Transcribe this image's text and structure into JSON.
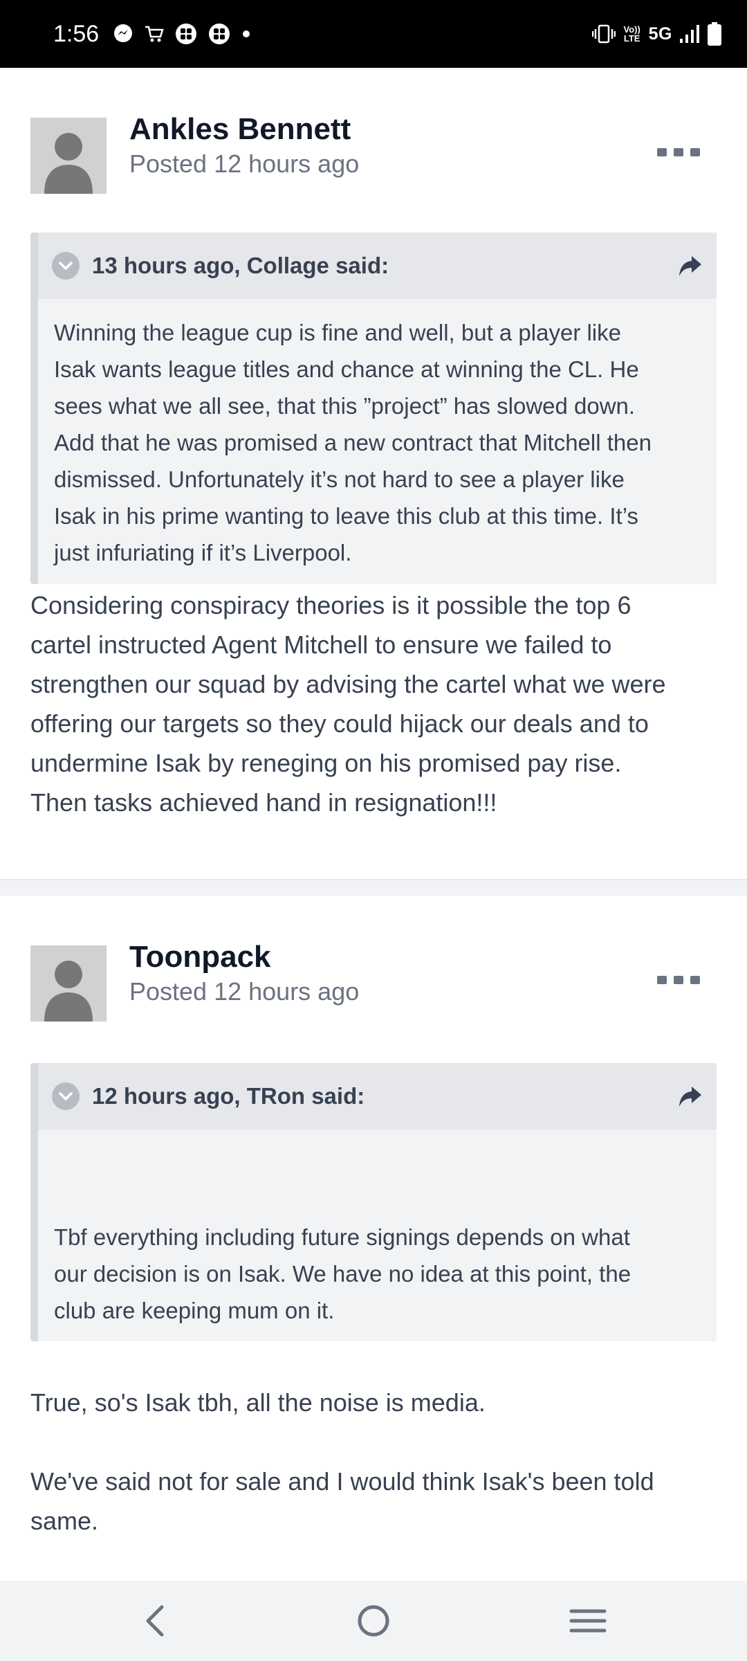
{
  "status_bar": {
    "time": "1:56",
    "network": "5G",
    "volte_top": "Vo))",
    "volte_bottom": "LTE"
  },
  "posts": [
    {
      "author": "Ankles Bennett",
      "posted": "Posted 12 hours ago",
      "quote": {
        "citation": "13 hours ago, Collage said:",
        "lines": [
          "Winning the league cup is fine and well, but a player like",
          "Isak wants league titles and chance at winning the CL. He",
          "sees what we all see, that this ”project” has slowed down.",
          "Add that he was promised a new contract that Mitchell then",
          "dismissed. Unfortunately it’s not hard to see a player like",
          "Isak in his prime wanting to leave this club at this time. It’s",
          "just infuriating if it’s Liverpool."
        ]
      },
      "body_lines": [
        "Considering conspiracy theories is it possible the top 6",
        "cartel instructed Agent Mitchell to ensure we failed to",
        "strengthen our squad by advising the cartel what we were",
        "offering our targets so they could hijack our deals and to",
        "undermine Isak by reneging on his promised pay rise.",
        "Then tasks achieved hand in resignation!!!"
      ]
    },
    {
      "author": "Toonpack",
      "posted": "Posted 12 hours ago",
      "quote": {
        "citation": "12 hours ago, TRon said:",
        "lines": [
          "Tbf everything including future signings depends on what",
          "our decision is on Isak. We have no idea at this point, the",
          "club are keeping mum on it."
        ]
      },
      "paragraphs": [
        "True, so's Isak tbh, all the noise is media.",
        "We've said not for sale and I would think Isak's been told",
        "same."
      ]
    }
  ],
  "icons": {
    "more": "more-options-icon",
    "toggle": "chevron-down-icon",
    "share": "share-arrow-icon",
    "back": "back-icon",
    "home": "home-icon",
    "recents": "recents-icon"
  }
}
